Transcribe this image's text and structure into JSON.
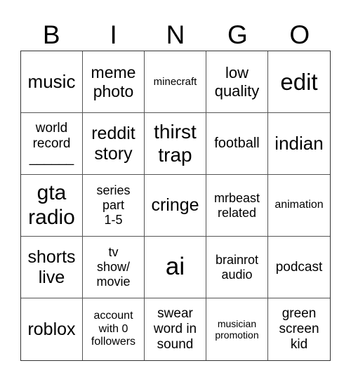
{
  "header": [
    "B",
    "I",
    "N",
    "G",
    "O"
  ],
  "cells": [
    "music",
    "meme\nphoto",
    "minecraft",
    "low\nquality",
    "edit",
    "world\nrecord\n______",
    "reddit\nstory",
    "thirst\ntrap",
    "football",
    "indian",
    "gta\nradio",
    "series\npart\n1-5",
    "cringe",
    "mrbeast\nrelated",
    "animation",
    "shorts\nlive",
    "tv\nshow/\nmovie",
    "ai",
    "brainrot\naudio",
    "podcast",
    "roblox",
    "account\nwith 0\nfollowers",
    "swear\nword in\nsound",
    "musician\npromotion",
    "green\nscreen\nkid"
  ]
}
